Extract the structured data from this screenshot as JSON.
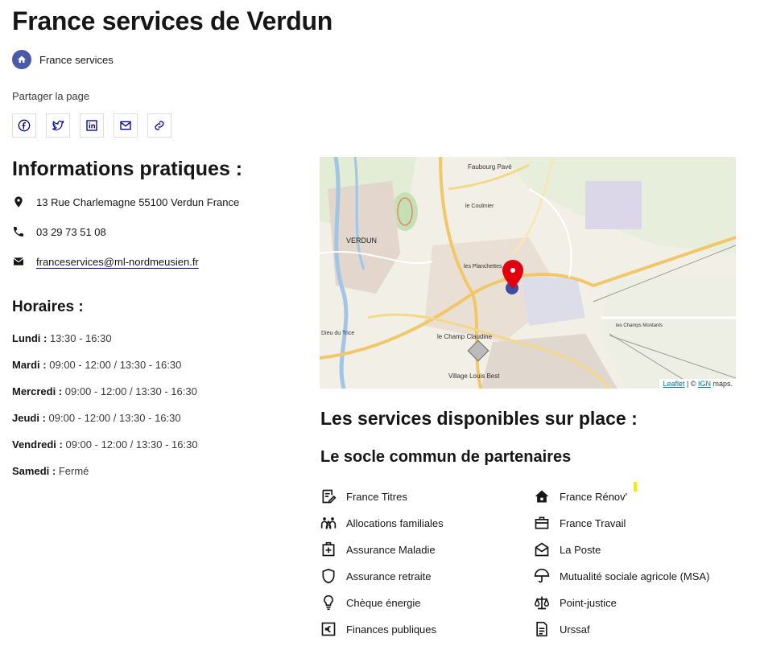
{
  "page": {
    "title": "France services de Verdun"
  },
  "breadcrumb": {
    "label": "France services"
  },
  "share": {
    "label": "Partager la page",
    "buttons": [
      "facebook-icon",
      "twitter-icon",
      "linkedin-icon",
      "mail-icon",
      "link-icon"
    ]
  },
  "info": {
    "title": "Informations pratiques :",
    "address": "13 Rue Charlemagne 55100 Verdun France",
    "phone": "03 29 73 51 08",
    "email": "franceservices@ml-nordmeusien.fr"
  },
  "hours": {
    "title": "Horaires :",
    "days": [
      {
        "day": "Lundi :",
        "time": "13:30 - 16:30"
      },
      {
        "day": "Mardi :",
        "time": "09:00 - 12:00 / 13:30 - 16:30"
      },
      {
        "day": "Mercredi :",
        "time": "09:00 - 12:00 / 13:30 - 16:30"
      },
      {
        "day": "Jeudi :",
        "time": "09:00 - 12:00 / 13:30 - 16:30"
      },
      {
        "day": "Vendredi :",
        "time": "09:00 - 12:00 / 13:30 - 16:30"
      },
      {
        "day": "Samedi :",
        "time": "Fermé"
      }
    ]
  },
  "map": {
    "labels": {
      "faubourg": "Faubourg Pavé",
      "coulmier": "le Coulmier",
      "verdun": "VERDUN",
      "planchettes": "les Planchettes",
      "trice": "Dieu du Trice",
      "claudine": "le Champ Claudine",
      "village": "Village Louis Best",
      "champs": "les Champs Montants"
    },
    "attribution": {
      "leaflet": "Leaflet",
      "sep": " | © ",
      "ign": "IGN",
      "suffix": " maps."
    }
  },
  "services": {
    "title": "Les services disponibles sur place :",
    "subtitle": "Le socle commun de partenaires",
    "left": [
      {
        "label": "France Titres",
        "icon": "edit-document-icon"
      },
      {
        "label": "Allocations familiales",
        "icon": "family-icon"
      },
      {
        "label": "Assurance Maladie",
        "icon": "health-kit-icon"
      },
      {
        "label": "Assurance retraite",
        "icon": "shield-icon"
      },
      {
        "label": "Chèque énergie",
        "icon": "lightbulb-icon"
      },
      {
        "label": "Finances publiques",
        "icon": "euro-icon"
      }
    ],
    "right": [
      {
        "label": "France Rénov'",
        "icon": "house-icon"
      },
      {
        "label": "France Travail",
        "icon": "briefcase-icon"
      },
      {
        "label": "La Poste",
        "icon": "mail-open-icon"
      },
      {
        "label": "Mutualité sociale agricole (MSA)",
        "icon": "umbrella-icon"
      },
      {
        "label": "Point-justice",
        "icon": "scales-icon"
      },
      {
        "label": "Urssaf",
        "icon": "file-text-icon"
      }
    ]
  },
  "colors": {
    "accent": "#000091",
    "home_badge": "#4a5aa8",
    "marker": "#e1000f"
  }
}
